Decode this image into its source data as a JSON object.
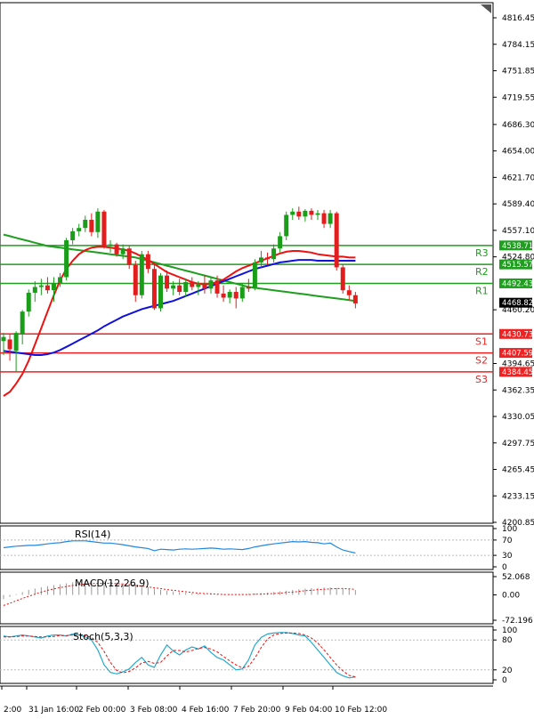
{
  "chart_data": {
    "type": "candlestick",
    "main": {
      "y_ticks": [
        "4816.45",
        "4784.15",
        "4751.85",
        "4719.55",
        "4686.30",
        "4654.00",
        "4621.70",
        "4589.40",
        "4557.10",
        "4524.80",
        "4460.20",
        "4394.65",
        "4362.35",
        "4330.05",
        "4297.75",
        "4265.45",
        "4233.15",
        "4200.85"
      ],
      "ylim": [
        4200.85,
        4816.45
      ],
      "x_labels": [
        "2:00",
        "31 Jan 16:00",
        "2 Feb 00:00",
        "3 Feb 08:00",
        "4 Feb 16:00",
        "7 Feb 20:00",
        "9 Feb 04:00",
        "10 Feb 12:00"
      ],
      "candles": [
        {
          "o": 4422,
          "h": 4432,
          "l": 4405,
          "c": 4427
        },
        {
          "o": 4424,
          "h": 4430,
          "l": 4398,
          "c": 4412
        },
        {
          "o": 4410,
          "h": 4434,
          "l": 4385,
          "c": 4432
        },
        {
          "o": 4430,
          "h": 4460,
          "l": 4418,
          "c": 4458
        },
        {
          "o": 4458,
          "h": 4485,
          "l": 4452,
          "c": 4481
        },
        {
          "o": 4481,
          "h": 4495,
          "l": 4470,
          "c": 4488
        },
        {
          "o": 4488,
          "h": 4498,
          "l": 4478,
          "c": 4490
        },
        {
          "o": 4490,
          "h": 4500,
          "l": 4480,
          "c": 4484
        },
        {
          "o": 4484,
          "h": 4500,
          "l": 4470,
          "c": 4493
        },
        {
          "o": 4493,
          "h": 4505,
          "l": 4488,
          "c": 4500
        },
        {
          "o": 4500,
          "h": 4548,
          "l": 4496,
          "c": 4545
        },
        {
          "o": 4545,
          "h": 4560,
          "l": 4540,
          "c": 4556
        },
        {
          "o": 4556,
          "h": 4565,
          "l": 4550,
          "c": 4560
        },
        {
          "o": 4560,
          "h": 4575,
          "l": 4555,
          "c": 4570
        },
        {
          "o": 4570,
          "h": 4578,
          "l": 4550,
          "c": 4555
        },
        {
          "o": 4555,
          "h": 4584,
          "l": 4548,
          "c": 4580
        },
        {
          "o": 4580,
          "h": 4582,
          "l": 4535,
          "c": 4538
        },
        {
          "o": 4538,
          "h": 4545,
          "l": 4530,
          "c": 4540
        },
        {
          "o": 4540,
          "h": 4542,
          "l": 4525,
          "c": 4528
        },
        {
          "o": 4528,
          "h": 4540,
          "l": 4522,
          "c": 4535
        },
        {
          "o": 4535,
          "h": 4538,
          "l": 4510,
          "c": 4515
        },
        {
          "o": 4515,
          "h": 4520,
          "l": 4470,
          "c": 4478
        },
        {
          "o": 4478,
          "h": 4532,
          "l": 4474,
          "c": 4528
        },
        {
          "o": 4528,
          "h": 4532,
          "l": 4505,
          "c": 4510
        },
        {
          "o": 4510,
          "h": 4515,
          "l": 4460,
          "c": 4462
        },
        {
          "o": 4462,
          "h": 4505,
          "l": 4458,
          "c": 4502
        },
        {
          "o": 4502,
          "h": 4508,
          "l": 4482,
          "c": 4486
        },
        {
          "o": 4486,
          "h": 4495,
          "l": 4478,
          "c": 4490
        },
        {
          "o": 4490,
          "h": 4498,
          "l": 4478,
          "c": 4482
        },
        {
          "o": 4482,
          "h": 4498,
          "l": 4476,
          "c": 4494
        },
        {
          "o": 4494,
          "h": 4500,
          "l": 4484,
          "c": 4488
        },
        {
          "o": 4488,
          "h": 4495,
          "l": 4478,
          "c": 4492
        },
        {
          "o": 4492,
          "h": 4502,
          "l": 4480,
          "c": 4486
        },
        {
          "o": 4486,
          "h": 4500,
          "l": 4480,
          "c": 4496
        },
        {
          "o": 4496,
          "h": 4502,
          "l": 4475,
          "c": 4480
        },
        {
          "o": 4480,
          "h": 4490,
          "l": 4470,
          "c": 4475
        },
        {
          "o": 4475,
          "h": 4485,
          "l": 4468,
          "c": 4482
        },
        {
          "o": 4482,
          "h": 4488,
          "l": 4462,
          "c": 4474
        },
        {
          "o": 4474,
          "h": 4492,
          "l": 4470,
          "c": 4488
        },
        {
          "o": 4488,
          "h": 4498,
          "l": 4482,
          "c": 4486
        },
        {
          "o": 4486,
          "h": 4522,
          "l": 4484,
          "c": 4518
        },
        {
          "o": 4518,
          "h": 4532,
          "l": 4512,
          "c": 4524
        },
        {
          "o": 4524,
          "h": 4530,
          "l": 4515,
          "c": 4522
        },
        {
          "o": 4522,
          "h": 4540,
          "l": 4518,
          "c": 4535
        },
        {
          "o": 4535,
          "h": 4555,
          "l": 4530,
          "c": 4550
        },
        {
          "o": 4550,
          "h": 4580,
          "l": 4545,
          "c": 4576
        },
        {
          "o": 4576,
          "h": 4584,
          "l": 4570,
          "c": 4580
        },
        {
          "o": 4580,
          "h": 4586,
          "l": 4570,
          "c": 4574
        },
        {
          "o": 4574,
          "h": 4583,
          "l": 4568,
          "c": 4581
        },
        {
          "o": 4581,
          "h": 4584,
          "l": 4570,
          "c": 4576
        },
        {
          "o": 4576,
          "h": 4582,
          "l": 4570,
          "c": 4578
        },
        {
          "o": 4578,
          "h": 4582,
          "l": 4560,
          "c": 4565
        },
        {
          "o": 4565,
          "h": 4582,
          "l": 4560,
          "c": 4578
        },
        {
          "o": 4578,
          "h": 4580,
          "l": 4508,
          "c": 4512
        },
        {
          "o": 4512,
          "h": 4515,
          "l": 4480,
          "c": 4484
        },
        {
          "o": 4484,
          "h": 4490,
          "l": 4472,
          "c": 4478
        },
        {
          "o": 4478,
          "h": 4482,
          "l": 4462,
          "c": 4468
        }
      ],
      "series": [
        {
          "name": "",
          "color": "#1f9e1f",
          "values": [
            4552,
            4550,
            4548,
            4546,
            4544,
            4542,
            4540,
            4538,
            4537,
            4536,
            4535,
            4534,
            4533,
            4532,
            4531,
            4530,
            4529,
            4528,
            4527,
            4526,
            4525,
            4524,
            4522,
            4520,
            4518,
            4516,
            4514,
            4512,
            4510,
            4508,
            4506,
            4504,
            4502,
            4500,
            4498,
            4496,
            4494,
            4492,
            4490,
            4488,
            4487,
            4486,
            4485,
            4484,
            4483,
            4482,
            4481,
            4480,
            4479,
            4478,
            4477,
            4476,
            4475,
            4474,
            4473,
            4472,
            4471
          ]
        },
        {
          "name": "",
          "color": "#ee1111",
          "values": [
            4355,
            4360,
            4370,
            4382,
            4398,
            4418,
            4438,
            4458,
            4478,
            4496,
            4510,
            4520,
            4528,
            4533,
            4536,
            4537,
            4537,
            4536,
            4535,
            4534,
            4532,
            4529,
            4525,
            4521,
            4516,
            4511,
            4506,
            4503,
            4500,
            4497,
            4494,
            4492,
            4491,
            4492,
            4494,
            4497,
            4502,
            4507,
            4511,
            4514,
            4517,
            4520,
            4523,
            4526,
            4529,
            4531,
            4532,
            4532,
            4531,
            4530,
            4528,
            4527,
            4526,
            4525,
            4525,
            4524,
            4524
          ]
        },
        {
          "name": "",
          "color": "#1111dd",
          "values": [
            4410,
            4409,
            4408,
            4407,
            4406,
            4405,
            4405,
            4406,
            4408,
            4411,
            4415,
            4419,
            4423,
            4427,
            4431,
            4435,
            4440,
            4444,
            4448,
            4452,
            4455,
            4458,
            4461,
            4463,
            4465,
            4467,
            4469,
            4471,
            4474,
            4477,
            4480,
            4483,
            4486,
            4489,
            4492,
            4495,
            4498,
            4501,
            4504,
            4507,
            4510,
            4512,
            4514,
            4516,
            4518,
            4519,
            4520,
            4521,
            4521,
            4521,
            4520,
            4520,
            4520,
            4520,
            4520,
            4520,
            4520
          ]
        }
      ],
      "current_price": "4468.82",
      "levels": [
        {
          "tag": "R3",
          "value": "4538.71",
          "color": "#1f9e1f"
        },
        {
          "tag": "R2",
          "value": "4515.57",
          "color": "#1f9e1f"
        },
        {
          "tag": "R1",
          "value": "4492.43",
          "color": "#1f9e1f"
        },
        {
          "tag": "S1",
          "value": "4430.73",
          "color": "#ee2222"
        },
        {
          "tag": "S2",
          "value": "4407.59",
          "color": "#ee2222"
        },
        {
          "tag": "S3",
          "value": "4384.45",
          "color": "#ee2222"
        }
      ]
    },
    "rsi": {
      "title": "RSI(14)",
      "y_ticks": [
        "100",
        "70",
        "30",
        "0"
      ],
      "ylim": [
        0,
        100
      ],
      "color": "#2288dd",
      "values": [
        50,
        52,
        54,
        55,
        56,
        56,
        58,
        60,
        62,
        63,
        66,
        68,
        68,
        68,
        66,
        64,
        62,
        62,
        60,
        58,
        55,
        52,
        50,
        48,
        42,
        46,
        45,
        44,
        46,
        47,
        46,
        47,
        48,
        49,
        48,
        46,
        47,
        46,
        45,
        48,
        52,
        55,
        58,
        60,
        62,
        64,
        66,
        65,
        66,
        64,
        63,
        60,
        62,
        52,
        44,
        40,
        36
      ]
    },
    "macd": {
      "title": "MACD(12,26,9)",
      "y_ticks": [
        "52.068",
        "0.00",
        "-72.196"
      ],
      "ylim": [
        -72.196,
        52.068
      ],
      "hist": [
        -12,
        -6,
        2,
        8,
        14,
        18,
        22,
        25,
        28,
        30,
        33,
        36,
        38,
        39,
        40,
        40,
        39,
        37,
        35,
        33,
        31,
        28,
        25,
        22,
        18,
        15,
        12,
        10,
        8,
        6,
        5,
        4,
        3,
        3,
        2,
        2,
        2,
        2,
        3,
        3,
        4,
        5,
        6,
        8,
        10,
        12,
        14,
        16,
        18,
        19,
        20,
        21,
        21,
        20,
        18,
        16,
        14
      ],
      "signal": [
        -30,
        -24,
        -17,
        -10,
        -4,
        2,
        8,
        13,
        17,
        21,
        24,
        27,
        29,
        31,
        32,
        33,
        33,
        33,
        32,
        31,
        29,
        27,
        25,
        23,
        20,
        18,
        15,
        13,
        11,
        9,
        7,
        5,
        4,
        3,
        2,
        1,
        1,
        1,
        1,
        1,
        2,
        2,
        3,
        4,
        5,
        7,
        8,
        10,
        12,
        13,
        15,
        16,
        17,
        18,
        18,
        17,
        16
      ],
      "signal_color": "#ee1111"
    },
    "stoch": {
      "title": "Stoch(5,3,3)",
      "y_ticks": [
        "100",
        "80",
        "20",
        "0"
      ],
      "ylim": [
        0,
        100
      ],
      "main_color": "#22aacc",
      "signal_color": "#ee1111",
      "main": [
        88,
        86,
        88,
        90,
        88,
        86,
        84,
        88,
        90,
        90,
        88,
        92,
        90,
        86,
        80,
        60,
        30,
        15,
        12,
        16,
        22,
        35,
        45,
        30,
        25,
        50,
        70,
        58,
        50,
        60,
        66,
        62,
        68,
        55,
        45,
        40,
        30,
        20,
        22,
        40,
        70,
        85,
        92,
        94,
        95,
        95,
        93,
        90,
        88,
        75,
        60,
        45,
        30,
        15,
        8,
        4,
        6
      ],
      "signal": [
        86,
        86,
        87,
        88,
        88,
        87,
        86,
        86,
        87,
        89,
        89,
        90,
        90,
        89,
        85,
        75,
        57,
        35,
        19,
        14,
        17,
        24,
        34,
        37,
        33,
        35,
        48,
        59,
        59,
        56,
        59,
        63,
        65,
        62,
        56,
        47,
        38,
        30,
        24,
        27,
        44,
        65,
        82,
        90,
        93,
        94,
        94,
        93,
        90,
        84,
        74,
        60,
        45,
        30,
        18,
        9,
        6
      ]
    }
  }
}
